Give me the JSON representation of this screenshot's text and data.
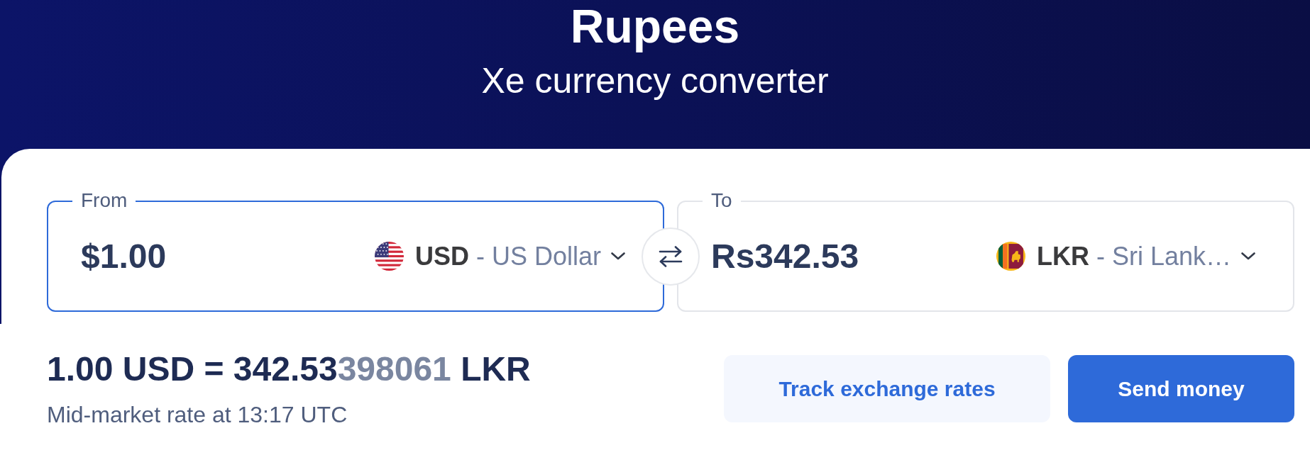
{
  "header": {
    "title": "Rupees",
    "subtitle": "Xe currency converter"
  },
  "converter": {
    "fields": [
      {
        "label": "From",
        "focused": true,
        "amount": "$1.00",
        "currency": {
          "code": "USD",
          "separator": "-",
          "name": "US Dollar"
        }
      },
      {
        "label": "To",
        "focused": false,
        "amount": "Rs342.53",
        "currency": {
          "code": "LKR",
          "separator": "-",
          "name": "Sri Lank…"
        }
      }
    ],
    "rate": {
      "main": "1.00 USD = 342.53",
      "extra_digits": "398061",
      "unit": "LKR",
      "note": "Mid-market rate at 13:17 UTC"
    },
    "buttons": [
      {
        "kind": "secondary",
        "label": "Track exchange rates"
      },
      {
        "kind": "primary",
        "label": "Send money"
      }
    ]
  }
}
